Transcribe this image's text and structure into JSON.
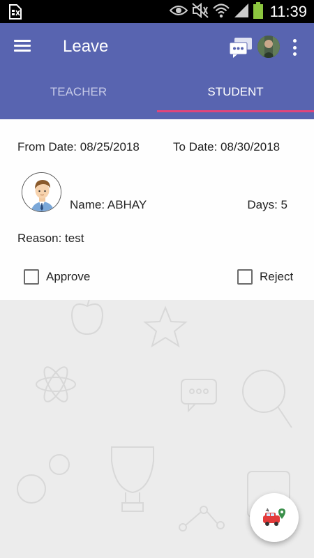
{
  "status_bar": {
    "time": "11:39",
    "icons": [
      "sim-card-icon",
      "eye-icon",
      "mute-icon",
      "wifi-icon",
      "signal-icon",
      "battery-icon"
    ]
  },
  "app_bar": {
    "title": "Leave",
    "icons": [
      "menu-icon",
      "chat-icon",
      "profile-avatar",
      "more-vert-icon"
    ],
    "color": "#5864b0"
  },
  "tabs": [
    {
      "label": "TEACHER",
      "selected": false
    },
    {
      "label": "STUDENT",
      "selected": true
    }
  ],
  "tab_indicator_color": "#e0457b",
  "leave_card": {
    "from_date": "From Date: 08/25/2018",
    "to_date": "To Date: 08/30/2018",
    "name": "Name: ABHAY",
    "days": "Days: 5",
    "reason": "Reason: test",
    "approve_label": "Approve",
    "reject_label": "Reject",
    "approve_checked": false,
    "reject_checked": false
  },
  "fab": {
    "icon": "bus-location-icon"
  }
}
